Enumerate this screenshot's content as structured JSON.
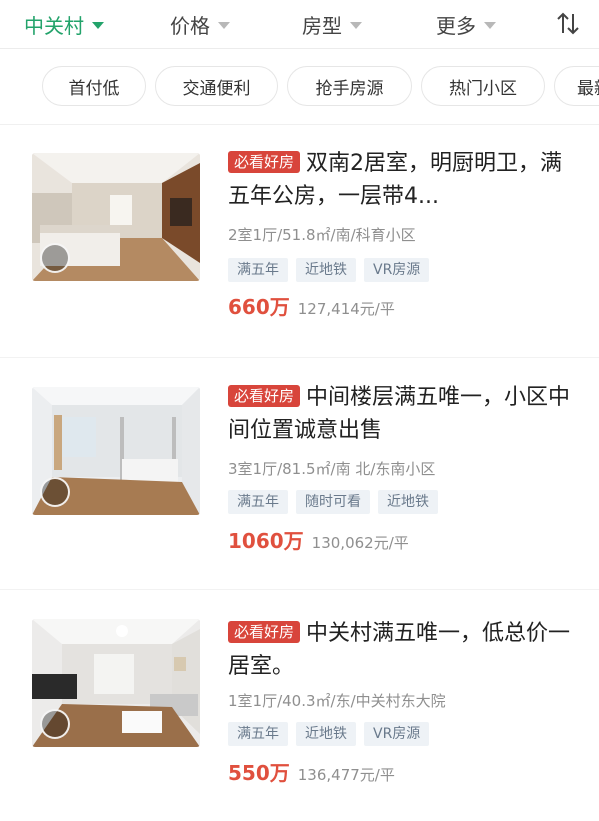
{
  "filters": [
    {
      "label": "中关村",
      "active": true
    },
    {
      "label": "价格",
      "active": false
    },
    {
      "label": "房型",
      "active": false
    },
    {
      "label": "更多",
      "active": false
    }
  ],
  "sort_icon": "sort-arrows-icon",
  "chips": [
    "首付低",
    "交通便利",
    "抢手房源",
    "热门小区",
    "最新"
  ],
  "listings": [
    {
      "badge": "必看好房",
      "title": "双南2居室，明厨明卫，满五年公房，一层带4...",
      "meta": "2室1厅/51.8㎡/南/科育小区",
      "tags": [
        "满五年",
        "近地铁",
        "VR房源"
      ],
      "price": "660万",
      "unit_price": "127,414元/平"
    },
    {
      "badge": "必看好房",
      "title": "中间楼层满五唯一，小区中间位置诚意出售",
      "meta": "3室1厅/81.5㎡/南 北/东南小区",
      "tags": [
        "满五年",
        "随时可看",
        "近地铁"
      ],
      "price": "1060万",
      "unit_price": "130,062元/平"
    },
    {
      "badge": "必看好房",
      "title": "中关村满五唯一，低总价一居室。",
      "meta": "1室1厅/40.3㎡/东/中关村东大院",
      "tags": [
        "满五年",
        "近地铁",
        "VR房源"
      ],
      "price": "550万",
      "unit_price": "136,477元/平"
    }
  ],
  "colors": {
    "accent": "#23a36b",
    "price": "#e0503e",
    "badge": "#d8453b"
  }
}
